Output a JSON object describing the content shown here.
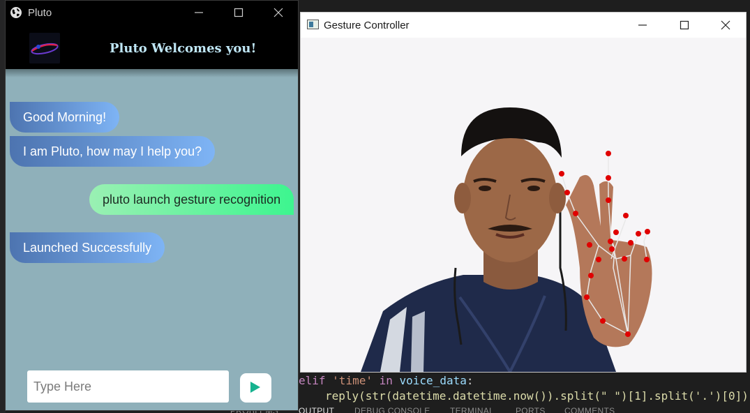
{
  "editor": {
    "code_line1": {
      "kw1": "elif",
      "str": "'time'",
      "kw2": "in",
      "var": "voice_data",
      "punct": ":"
    },
    "code_line2": "reply(str(datetime.datetime.now()).split(\" \")[1].split('.')[0])",
    "panel_tabs": [
      "PROBLEMS",
      "OUTPUT",
      "DEBUG CONSOLE",
      "TERMINAL",
      "PORTS",
      "COMMENTS"
    ]
  },
  "pluto": {
    "window_title": "Pluto",
    "welcome": "Pluto Welcomes you!",
    "messages": [
      {
        "from": "bot",
        "text": "Good Morning!"
      },
      {
        "from": "bot",
        "text": "I am Pluto, how may I help you?"
      },
      {
        "from": "user",
        "text": "pluto launch gesture recognition"
      },
      {
        "from": "bot",
        "text": "Launched Successfully"
      }
    ],
    "input": {
      "value": "",
      "placeholder": "Type Here"
    },
    "send_icon": "play-triangle-icon",
    "colors": {
      "background": "#8fb0ba",
      "bot_bubble": "#5b86c6",
      "user_bubble": "#5cf59a",
      "send_icon": "#16b28f"
    }
  },
  "gesture": {
    "window_title": "Gesture Controller",
    "camera_feed": "webcam-person-hand-landmarks",
    "landmark_color": "#e00000"
  },
  "window_controls": [
    "minimize-icon",
    "maximize-icon",
    "close-icon"
  ]
}
